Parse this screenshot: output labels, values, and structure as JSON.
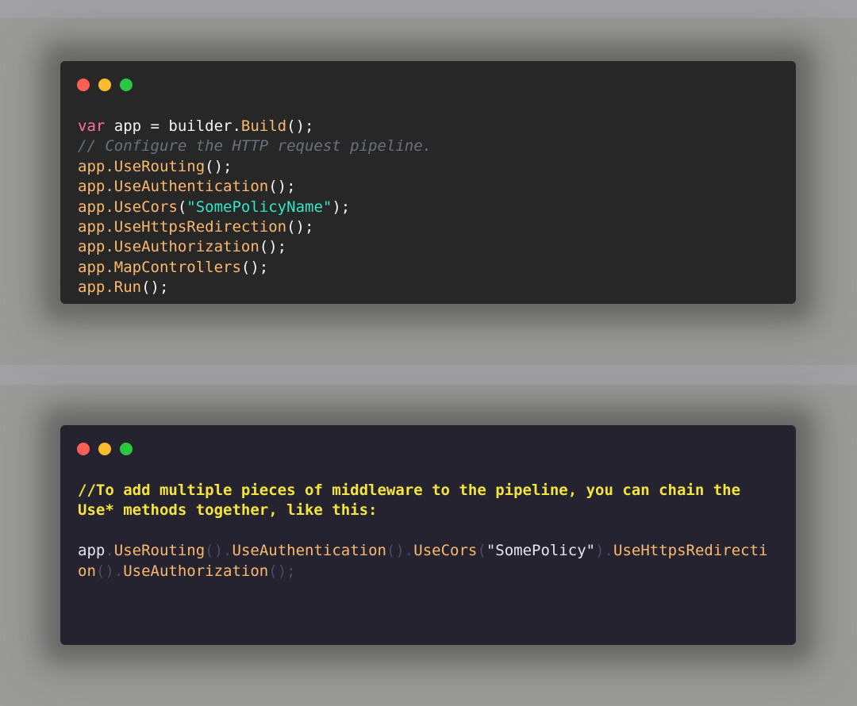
{
  "window_top": {
    "lines": [
      [
        {
          "t": "var",
          "c": "kw"
        },
        {
          "t": " app = builder.",
          "c": "pn"
        },
        {
          "t": "Build",
          "c": "fn"
        },
        {
          "t": "();",
          "c": "pn"
        }
      ],
      [
        {
          "t": "// Configure the HTTP request pipeline.",
          "c": "cm"
        }
      ],
      [
        {
          "t": "app.",
          "c": "fn"
        },
        {
          "t": "UseRouting",
          "c": "fn"
        },
        {
          "t": "();",
          "c": "pn"
        }
      ],
      [
        {
          "t": "app.",
          "c": "fn"
        },
        {
          "t": "UseAuthentication",
          "c": "fn"
        },
        {
          "t": "();",
          "c": "pn"
        }
      ],
      [
        {
          "t": "app.",
          "c": "fn"
        },
        {
          "t": "UseCors",
          "c": "fn"
        },
        {
          "t": "(",
          "c": "pn"
        },
        {
          "t": "\"SomePolicyName\"",
          "c": "st"
        },
        {
          "t": ");",
          "c": "pn"
        }
      ],
      [
        {
          "t": "app.",
          "c": "fn"
        },
        {
          "t": "UseHttpsRedirection",
          "c": "fn"
        },
        {
          "t": "();",
          "c": "pn"
        }
      ],
      [
        {
          "t": "app.",
          "c": "fn"
        },
        {
          "t": "UseAuthorization",
          "c": "fn"
        },
        {
          "t": "();",
          "c": "pn"
        }
      ],
      [
        {
          "t": "app.",
          "c": "fn"
        },
        {
          "t": "MapControllers",
          "c": "fn"
        },
        {
          "t": "();",
          "c": "pn"
        }
      ],
      [
        {
          "t": "app.",
          "c": "fn"
        },
        {
          "t": "Run",
          "c": "fn"
        },
        {
          "t": "();",
          "c": "pn"
        }
      ]
    ]
  },
  "window_bottom": {
    "lines": [
      [
        {
          "t": "//To add multiple pieces of middleware to the pipeline, you can chain the",
          "c": "cm2"
        }
      ],
      [
        {
          "t": "Use* methods together, like this:",
          "c": "cm2"
        }
      ],
      [],
      [
        {
          "t": "app",
          "c": "obj"
        },
        {
          "t": ".",
          "c": "dim"
        },
        {
          "t": "UseRouting",
          "c": "fn2"
        },
        {
          "t": "().",
          "c": "dim"
        },
        {
          "t": "UseAuthentication",
          "c": "fn2"
        },
        {
          "t": "().",
          "c": "dim"
        },
        {
          "t": "UseCors",
          "c": "fn2"
        },
        {
          "t": "(",
          "c": "dim"
        },
        {
          "t": "\"SomePolicy\"",
          "c": "obj"
        },
        {
          "t": ").",
          "c": "dim"
        },
        {
          "t": "UseHttpsRedirecti",
          "c": "fn2"
        }
      ],
      [
        {
          "t": "on",
          "c": "fn2"
        },
        {
          "t": "().",
          "c": "dim"
        },
        {
          "t": "UseAuthorization",
          "c": "fn2"
        },
        {
          "t": "();",
          "c": "dim"
        }
      ]
    ]
  },
  "colors": {
    "keyword": "#ff6ea8",
    "function": "#fbb96e",
    "comment": "#69707e",
    "string": "#31e8c6",
    "highlight_comment": "#f3e53e"
  }
}
